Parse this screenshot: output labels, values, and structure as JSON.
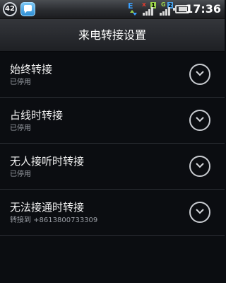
{
  "status_bar": {
    "notification_count": "42",
    "signal_1_label": "1",
    "signal_2_label": "2",
    "net_letter": "E",
    "g_letter": "G",
    "x_letter": "x",
    "time": "17:36"
  },
  "header": {
    "title": "来电转接设置"
  },
  "items": [
    {
      "title": "始终转接",
      "subtitle": "已停用"
    },
    {
      "title": "占线时转接",
      "subtitle": "已停用"
    },
    {
      "title": "无人接听时转接",
      "subtitle": "已停用"
    },
    {
      "title": "无法接通时转接",
      "subtitle": "转接到 +8613800733309"
    }
  ],
  "colors": {
    "background": "#0b0d11",
    "divider": "#2a2d33",
    "title_text": "#f2f2f2",
    "subtitle_text": "#9a9ea5"
  }
}
